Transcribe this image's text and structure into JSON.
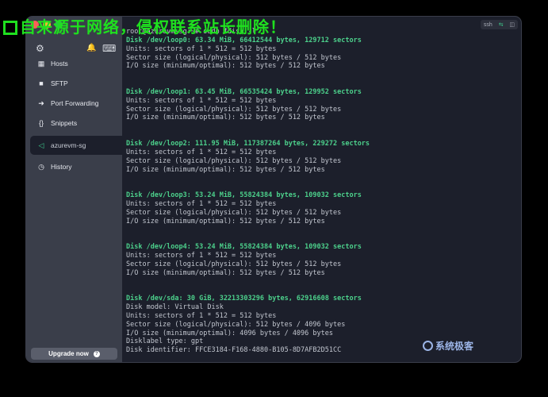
{
  "watermark": "自来源于网络，侵权联系站长删除！",
  "sidebar": {
    "items": [
      {
        "label": "Hosts",
        "icon": "hosts-icon",
        "glyph": "▦"
      },
      {
        "label": "SFTP",
        "icon": "folder-icon",
        "glyph": "■"
      },
      {
        "label": "Port Forwarding",
        "icon": "forward-icon",
        "glyph": "➜"
      },
      {
        "label": "Snippets",
        "icon": "braces-icon",
        "glyph": "{}"
      },
      {
        "label": "azurevm-sg",
        "icon": "terminal-tab-icon",
        "glyph": "◁"
      },
      {
        "label": "History",
        "icon": "clock-icon",
        "glyph": "◷"
      }
    ],
    "upgrade_label": "Upgrade now",
    "upgrade_icon": "?"
  },
  "toolbar": {
    "settings_glyph": "⚙",
    "bell_glyph": "🔔",
    "terminal_glyph": "⌨"
  },
  "terminal": {
    "prompt": "root@azurevm-sg:~# sudo fdisk -l",
    "blocks": [
      {
        "header": "Disk /dev/loop0: 63.34 MiB, 66412544 bytes, 129712 sectors",
        "lines": [
          "Units: sectors of 1 * 512 = 512 bytes",
          "Sector size (logical/physical): 512 bytes / 512 bytes",
          "I/O size (minimum/optimal): 512 bytes / 512 bytes"
        ]
      },
      {
        "header": "Disk /dev/loop1: 63.45 MiB, 66535424 bytes, 129952 sectors",
        "lines": [
          "Units: sectors of 1 * 512 = 512 bytes",
          "Sector size (logical/physical): 512 bytes / 512 bytes",
          "I/O size (minimum/optimal): 512 bytes / 512 bytes"
        ]
      },
      {
        "header": "Disk /dev/loop2: 111.95 MiB, 117387264 bytes, 229272 sectors",
        "lines": [
          "Units: sectors of 1 * 512 = 512 bytes",
          "Sector size (logical/physical): 512 bytes / 512 bytes",
          "I/O size (minimum/optimal): 512 bytes / 512 bytes"
        ]
      },
      {
        "header": "Disk /dev/loop3: 53.24 MiB, 55824384 bytes, 109032 sectors",
        "lines": [
          "Units: sectors of 1 * 512 = 512 bytes",
          "Sector size (logical/physical): 512 bytes / 512 bytes",
          "I/O size (minimum/optimal): 512 bytes / 512 bytes"
        ]
      },
      {
        "header": "Disk /dev/loop4: 53.24 MiB, 55824384 bytes, 109032 sectors",
        "lines": [
          "Units: sectors of 1 * 512 = 512 bytes",
          "Sector size (logical/physical): 512 bytes / 512 bytes",
          "I/O size (minimum/optimal): 512 bytes / 512 bytes"
        ]
      },
      {
        "header": "Disk /dev/sda: 30 GiB, 32213303296 bytes, 62916608 sectors",
        "lines": [
          "Disk model: Virtual Disk",
          "Units: sectors of 1 * 512 = 512 bytes",
          "Sector size (logical/physical): 512 bytes / 4096 bytes",
          "I/O size (minimum/optimal): 4096 bytes / 4096 bytes",
          "Disklabel type: gpt",
          "Disk identifier: FFCE3184-F168-4880-B105-8D7AFB2D51CC"
        ]
      }
    ]
  },
  "window_controls": {
    "text": "ssh",
    "go_glyph": "⇆",
    "split_glyph": "◫"
  },
  "brand_logo": "系统极客"
}
